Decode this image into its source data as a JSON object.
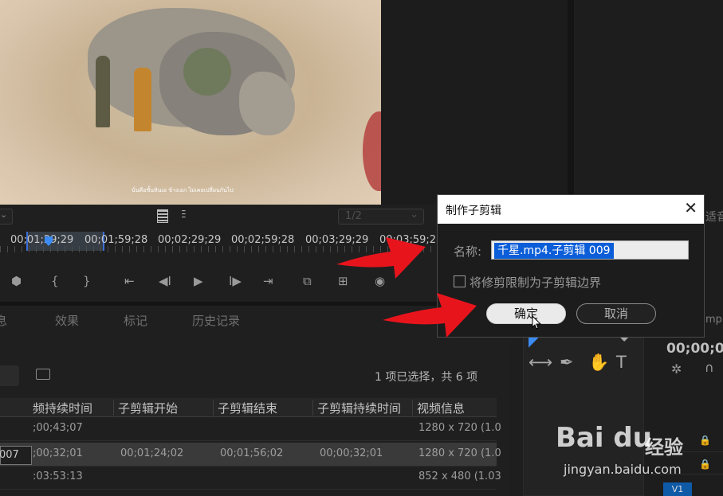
{
  "monitor": {
    "subtitle": "นั่นคือชั้นหินเอ ข้างเอก ไม่เคยเปลี่ยนกันไป",
    "resolution_dropdown": "1/2",
    "timecodes": [
      "00;01;29;29",
      "00;01;59;28",
      "00;02;29;29",
      "00;02;59;28",
      "00;03;29;29",
      "00;03;59;28"
    ]
  },
  "project_panel": {
    "tabs": [
      "息",
      "效果",
      "标记",
      "历史记录"
    ],
    "selection_status": "1 项已选择，共 6 项",
    "columns": [
      "频持续时间",
      "子剪辑开始",
      "子剪辑结束",
      "子剪辑持续时间",
      "视频信息"
    ],
    "rows": [
      {
        "name": "",
        "duration": ";00;43;07",
        "start": "",
        "end": "",
        "sub_duration": "",
        "video_info": "1280 x 720 (1.0"
      },
      {
        "name": "007",
        "duration": ";00;32;01",
        "start": "00;01;24;02",
        "end": "00;01;56;02",
        "sub_duration": "00;00;32;01",
        "video_info": "1280 x 720 (1.0"
      },
      {
        "name": "",
        "duration": ":03:53:13",
        "start": "",
        "end": "",
        "sub_duration": "",
        "video_info": "852 x 480 (1.03"
      }
    ]
  },
  "timeline": {
    "tab_fragment": "mp",
    "timecode": "00;00;0",
    "track_v1": "V1",
    "header_fragment": "适音"
  },
  "dialog": {
    "title": "制作子剪辑",
    "close_glyph": "✕",
    "name_label": "名称:",
    "name_value": "千星.mp4.子剪辑 009",
    "checkbox_label": "将修剪限制为子剪辑边界",
    "ok_label": "确定",
    "cancel_label": "取消"
  },
  "watermark": {
    "logo": "Bai du",
    "logo_suffix": "经验",
    "url": "jingyan.baidu.com"
  },
  "colors": {
    "accent_blue": "#0b5ed8",
    "arrow_red": "#e8141c",
    "panel_bg": "#1f1f1f"
  }
}
